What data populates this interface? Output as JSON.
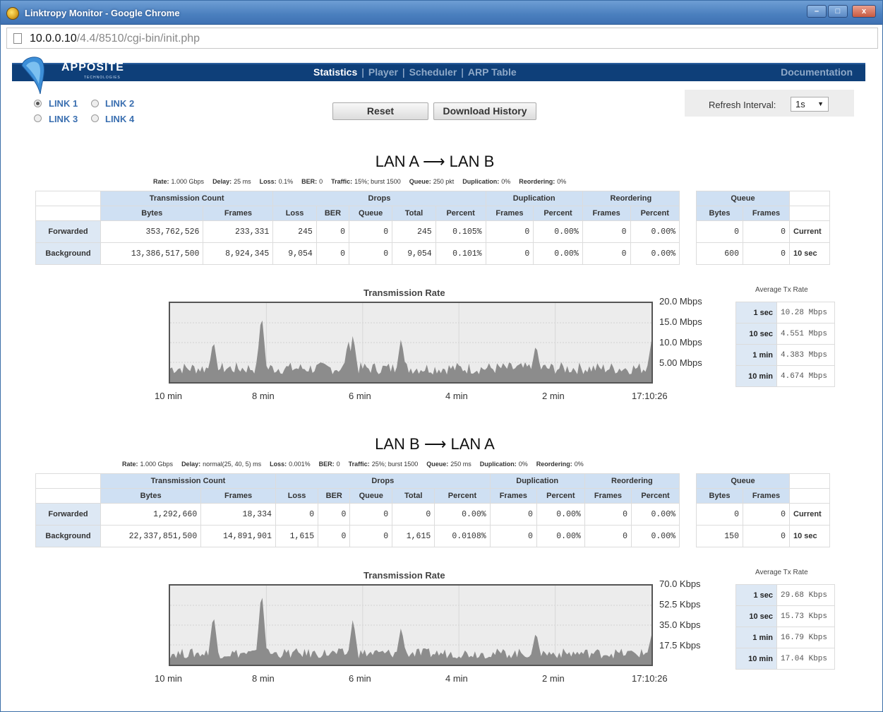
{
  "window": {
    "title": "Linktropy Monitor - Google Chrome",
    "controls": [
      "–",
      "□",
      "x"
    ]
  },
  "address": {
    "host": "10.0.0.10",
    "path": "/4.4/8510/cgi-bin/init.php"
  },
  "brand": {
    "name": "APPOSITE",
    "sub": "TECHNOLOGIES"
  },
  "nav": {
    "items": [
      "Statistics",
      "Player",
      "Scheduler",
      "ARP Table"
    ],
    "active": "Statistics",
    "doc": "Documentation"
  },
  "links": {
    "items": [
      "LINK 1",
      "LINK 2",
      "LINK 3",
      "LINK 4"
    ],
    "selected": "LINK 1"
  },
  "buttons": {
    "reset": "Reset",
    "download": "Download History"
  },
  "refresh": {
    "label": "Refresh Interval:",
    "value": "1s"
  },
  "table_headers": {
    "groups": [
      "Transmission Count",
      "Drops",
      "Duplication",
      "Reordering",
      "Queue"
    ],
    "cols": [
      "Bytes",
      "Frames",
      "Loss",
      "BER",
      "Queue",
      "Total",
      "Percent",
      "Frames",
      "Percent",
      "Frames",
      "Percent"
    ],
    "queue_cols": [
      "Bytes",
      "Frames"
    ],
    "rows": [
      "Forwarded",
      "Background"
    ],
    "tags": [
      "Current",
      "10 sec"
    ]
  },
  "sections": [
    {
      "title": "LAN A ⟶ LAN B",
      "params": [
        {
          "k": "Rate:",
          "v": "1.000 Gbps"
        },
        {
          "k": "Delay:",
          "v": "25 ms"
        },
        {
          "k": "Loss:",
          "v": "0.1%"
        },
        {
          "k": "BER:",
          "v": "0"
        },
        {
          "k": "Traffic:",
          "v": "15%; burst 1500"
        },
        {
          "k": "Queue:",
          "v": "250 pkt"
        },
        {
          "k": "Duplication:",
          "v": "0%"
        },
        {
          "k": "Reordering:",
          "v": "0%"
        }
      ],
      "rows": [
        [
          "353,762,526",
          "233,331",
          "245",
          "0",
          "0",
          "245",
          "0.105%",
          "0",
          "0.00%",
          "0",
          "0.00%"
        ],
        [
          "13,386,517,500",
          "8,924,345",
          "9,054",
          "0",
          "0",
          "9,054",
          "0.101%",
          "0",
          "0.00%",
          "0",
          "0.00%"
        ]
      ],
      "queue": [
        [
          "0",
          "0"
        ],
        [
          "600",
          "0"
        ]
      ],
      "chart_title": "Transmission Rate",
      "y_labels": [
        "20.0 Mbps",
        "15.0 Mbps",
        "10.0 Mbps",
        "5.00 Mbps"
      ],
      "x_labels": [
        "10 min",
        "8 min",
        "6 min",
        "4 min",
        "2 min",
        "17:10:26"
      ],
      "avg_title": "Average Tx Rate",
      "avg": [
        {
          "k": "1 sec",
          "v": "10.28 Mbps"
        },
        {
          "k": "10 sec",
          "v": "4.551 Mbps"
        },
        {
          "k": "1 min",
          "v": "4.383 Mbps"
        },
        {
          "k": "10 min",
          "v": "4.674 Mbps"
        }
      ]
    },
    {
      "title": "LAN B ⟶ LAN A",
      "params": [
        {
          "k": "Rate:",
          "v": "1.000 Gbps"
        },
        {
          "k": "Delay:",
          "v": "normal(25, 40, 5) ms"
        },
        {
          "k": "Loss:",
          "v": "0.001%"
        },
        {
          "k": "BER:",
          "v": "0"
        },
        {
          "k": "Traffic:",
          "v": "25%; burst 1500"
        },
        {
          "k": "Queue:",
          "v": "250 ms"
        },
        {
          "k": "Duplication:",
          "v": "0%"
        },
        {
          "k": "Reordering:",
          "v": "0%"
        }
      ],
      "rows": [
        [
          "1,292,660",
          "18,334",
          "0",
          "0",
          "0",
          "0",
          "0.00%",
          "0",
          "0.00%",
          "0",
          "0.00%"
        ],
        [
          "22,337,851,500",
          "14,891,901",
          "1,615",
          "0",
          "0",
          "1,615",
          "0.0108%",
          "0",
          "0.00%",
          "0",
          "0.00%"
        ]
      ],
      "queue": [
        [
          "0",
          "0"
        ],
        [
          "150",
          "0"
        ]
      ],
      "chart_title": "Transmission Rate",
      "y_labels": [
        "70.0 Kbps",
        "52.5 Kbps",
        "35.0 Kbps",
        "17.5 Kbps"
      ],
      "x_labels": [
        "10 min",
        "8 min",
        "6 min",
        "4 min",
        "2 min",
        "17:10:26"
      ],
      "avg_title": "Average Tx Rate",
      "avg": [
        {
          "k": "1 sec",
          "v": "29.68 Kbps"
        },
        {
          "k": "10 sec",
          "v": "15.73 Kbps"
        },
        {
          "k": "1 min",
          "v": "16.79 Kbps"
        },
        {
          "k": "10 min",
          "v": "17.04 Kbps"
        }
      ]
    }
  ],
  "chart_data": [
    {
      "type": "area",
      "title": "Transmission Rate",
      "ylim": [
        0,
        20
      ],
      "unit": "Mbps",
      "x_ticks": [
        "10 min",
        "8 min",
        "6 min",
        "4 min",
        "2 min",
        "17:10:26"
      ],
      "peaks": [
        [
          0.09,
          9.5
        ],
        [
          0.19,
          16.5
        ],
        [
          0.37,
          9.5
        ],
        [
          0.38,
          11
        ],
        [
          0.38,
          11
        ],
        [
          0.38,
          11
        ],
        [
          0.48,
          10
        ],
        [
          0.76,
          8.5
        ],
        [
          1.0,
          9
        ]
      ],
      "baseline": 3.5,
      "series_color": "#8c8c8c"
    },
    {
      "type": "area",
      "title": "Transmission Rate",
      "ylim": [
        0,
        70
      ],
      "unit": "Kbps",
      "x_ticks": [
        "10 min",
        "8 min",
        "6 min",
        "4 min",
        "2 min",
        "17:10:26"
      ],
      "peaks": [
        [
          0.09,
          42
        ],
        [
          0.19,
          64
        ],
        [
          0.38,
          38
        ],
        [
          0.48,
          30
        ],
        [
          0.76,
          26
        ],
        [
          1.0,
          22
        ]
      ],
      "baseline": 10,
      "series_color": "#8c8c8c"
    }
  ]
}
